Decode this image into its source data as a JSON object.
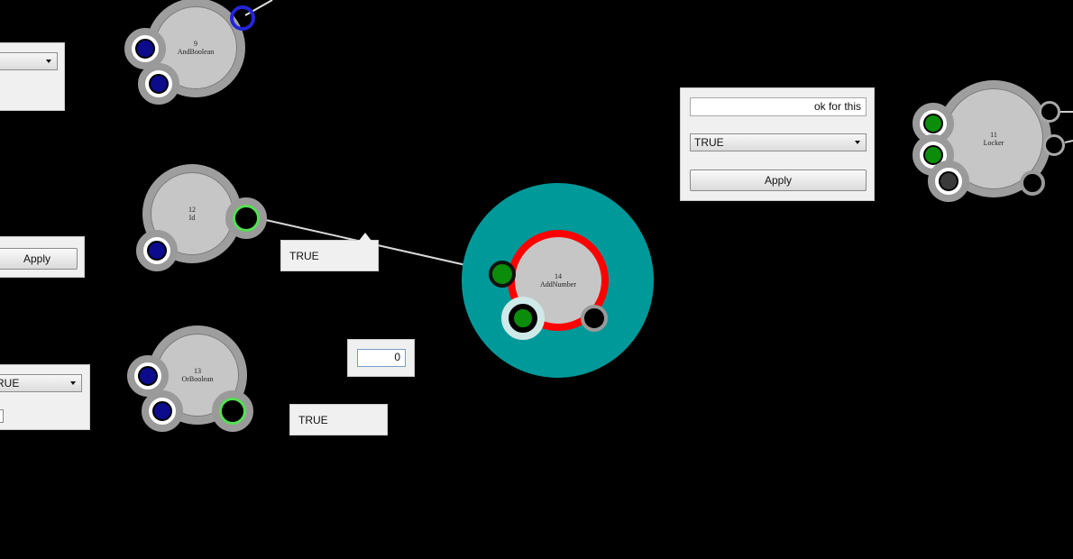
{
  "nodes": {
    "and_boolean": {
      "id": "9",
      "name": "AndBoolean"
    },
    "id_node": {
      "id": "12",
      "name": "Id"
    },
    "or_boolean": {
      "id": "13",
      "name": "OrBoolean"
    },
    "add_number": {
      "id": "14",
      "name": "AddNumber"
    },
    "locker": {
      "id": "11",
      "name": "Locker"
    }
  },
  "panels": {
    "locker_panel": {
      "text_value": "ok for this",
      "select_value": "TRUE",
      "apply_label": "Apply"
    },
    "left_apply_label": "Apply",
    "left_select_value": "RUE"
  },
  "outputs": {
    "id_output": "TRUE",
    "or_output": "TRUE",
    "number_input": "0"
  },
  "colors": {
    "background": "#000000",
    "selection_halo": "#009999",
    "active_ring": "#ff0000",
    "active_port": "#54e054",
    "input_port": "#0b0b8c",
    "output_port": "#0b8c0b"
  }
}
